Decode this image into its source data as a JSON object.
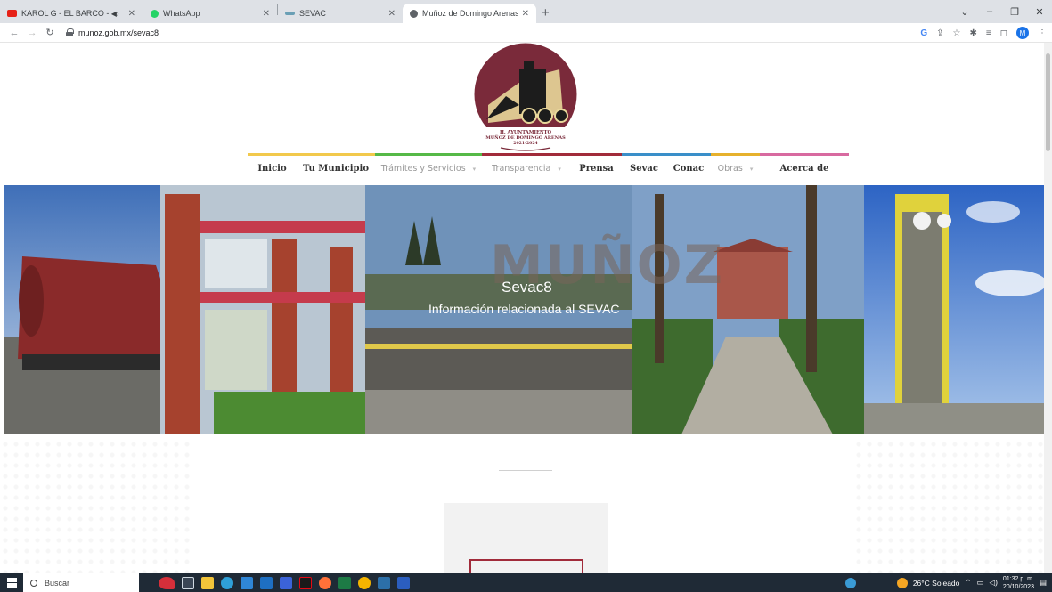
{
  "browser": {
    "tabs": [
      {
        "title": "KAROL G - EL BARCO - You",
        "extra": "◀›",
        "icon_color": "#e62117"
      },
      {
        "title": "WhatsApp",
        "icon_color": "#25d366"
      },
      {
        "title": "SEVAC",
        "icon_color": "#6a9fb5"
      },
      {
        "title": "Muñoz de Domingo Arenas",
        "icon_color": "#5f6368",
        "active": true
      }
    ],
    "new_tab": "+",
    "url": "munoz.gob.mx/sevac8",
    "profile_initial": "M"
  },
  "site": {
    "logo_text": {
      "line1": "H. AYUNTAMIENTO",
      "line2": "MUÑOZ DE DOMINGO ARENAS",
      "line3": "2021-2024"
    },
    "nav": [
      {
        "label": "Inicio",
        "style": "bold",
        "color": "#f2c94c"
      },
      {
        "label": "Tu Municipio",
        "style": "bold",
        "color": "#f2c94c"
      },
      {
        "label": "Trámites y Servicios",
        "style": "light",
        "dropdown": true,
        "color": "#56b947"
      },
      {
        "label": "Transparencia",
        "style": "light",
        "dropdown": true,
        "color": "#a12b3a"
      },
      {
        "label": "Prensa",
        "style": "bold",
        "color": "#a12b3a"
      },
      {
        "label": "Sevac",
        "style": "bold",
        "color": "#3a8fc9"
      },
      {
        "label": "Conac",
        "style": "bold",
        "color": "#3a8fc9"
      },
      {
        "label": "Obras",
        "style": "light",
        "dropdown": true,
        "color": "#e6b12d"
      },
      {
        "label": "Acerca de",
        "style": "bold",
        "color": "#d86aa0"
      }
    ],
    "hero": {
      "title": "MUÑOZ",
      "subtitle": "Sevac8",
      "description": "Información relacionada al SEVAC"
    }
  },
  "taskbar": {
    "search_placeholder": "Buscar",
    "weather": "26°C  Soleado",
    "time": "01:32 p. m.",
    "date": "20/10/2023"
  }
}
